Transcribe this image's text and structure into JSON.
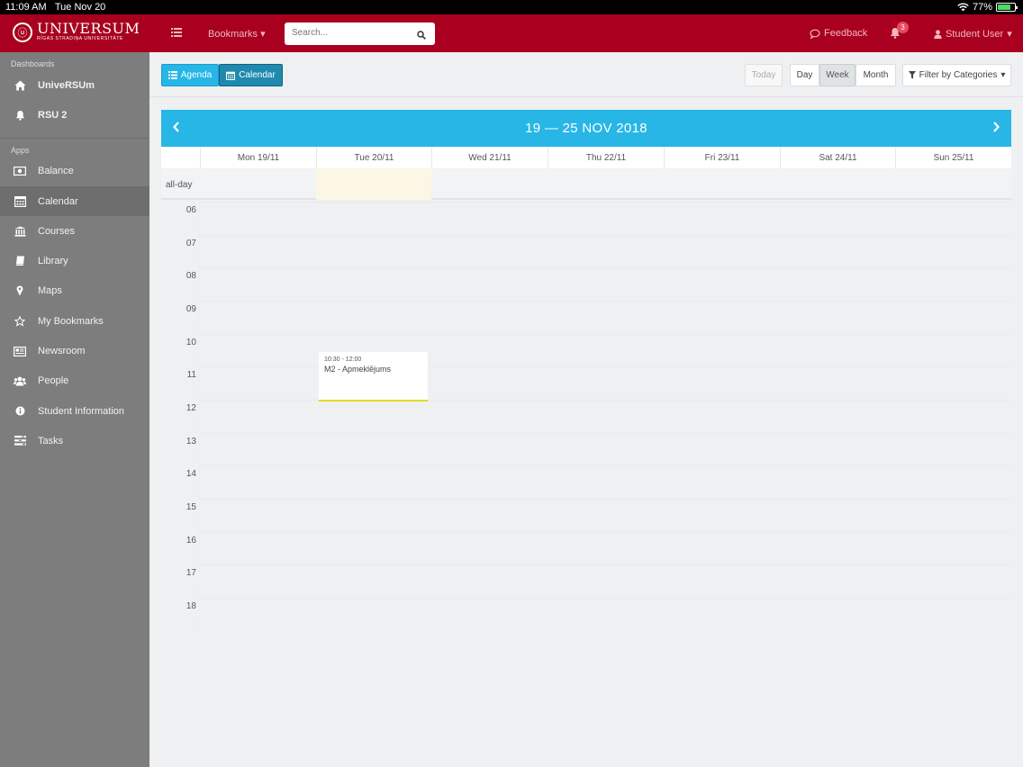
{
  "status_bar": {
    "time": "11:09 AM",
    "date": "Tue Nov 20",
    "battery": "77%"
  },
  "header": {
    "logo_title": "UNIVERSUM",
    "logo_subtitle": "RĪGAS STRADIŅA UNIVERSITĀTE",
    "bookmarks_label": "Bookmarks",
    "search_placeholder": "Search...",
    "feedback_label": "Feedback",
    "notifications_count": "3",
    "user_label": "Student User"
  },
  "sidebar": {
    "dashboards_label": "Dashboards",
    "dashboards": [
      {
        "label": "UniveRSUm",
        "icon": "home-icon"
      },
      {
        "label": "RSU 2",
        "icon": "bell-icon"
      }
    ],
    "apps_label": "Apps",
    "apps": [
      {
        "label": "Balance",
        "icon": "money-icon"
      },
      {
        "label": "Calendar",
        "icon": "calendar-icon",
        "active": true
      },
      {
        "label": "Courses",
        "icon": "institution-icon"
      },
      {
        "label": "Library",
        "icon": "book-icon"
      },
      {
        "label": "Maps",
        "icon": "map-marker-icon"
      },
      {
        "label": "My Bookmarks",
        "icon": "star-icon"
      },
      {
        "label": "Newsroom",
        "icon": "newspaper-icon"
      },
      {
        "label": "People",
        "icon": "users-icon"
      },
      {
        "label": "Student Information",
        "icon": "info-icon"
      },
      {
        "label": "Tasks",
        "icon": "tasks-icon"
      }
    ]
  },
  "toolbar": {
    "agenda_label": "Agenda",
    "calendar_label": "Calendar",
    "today_label": "Today",
    "day_label": "Day",
    "week_label": "Week",
    "month_label": "Month",
    "filter_label": "Filter by Categories"
  },
  "calendar": {
    "range_title": "19 — 25 NOV 2018",
    "days": [
      "Mon 19/11",
      "Tue 20/11",
      "Wed 21/11",
      "Thu 22/11",
      "Fri 23/11",
      "Sat 24/11",
      "Sun 25/11"
    ],
    "allday_label": "all-day",
    "hours": [
      "06",
      "07",
      "08",
      "09",
      "10",
      "11",
      "12",
      "13",
      "14",
      "15",
      "16",
      "17",
      "18"
    ],
    "event": {
      "time": "10:30 - 12:00",
      "title": "M2 - Apmeklējums"
    }
  },
  "colors": {
    "brand": "#a8001e",
    "accent": "#27b6e6",
    "sidebar": "#7d7d7d"
  }
}
